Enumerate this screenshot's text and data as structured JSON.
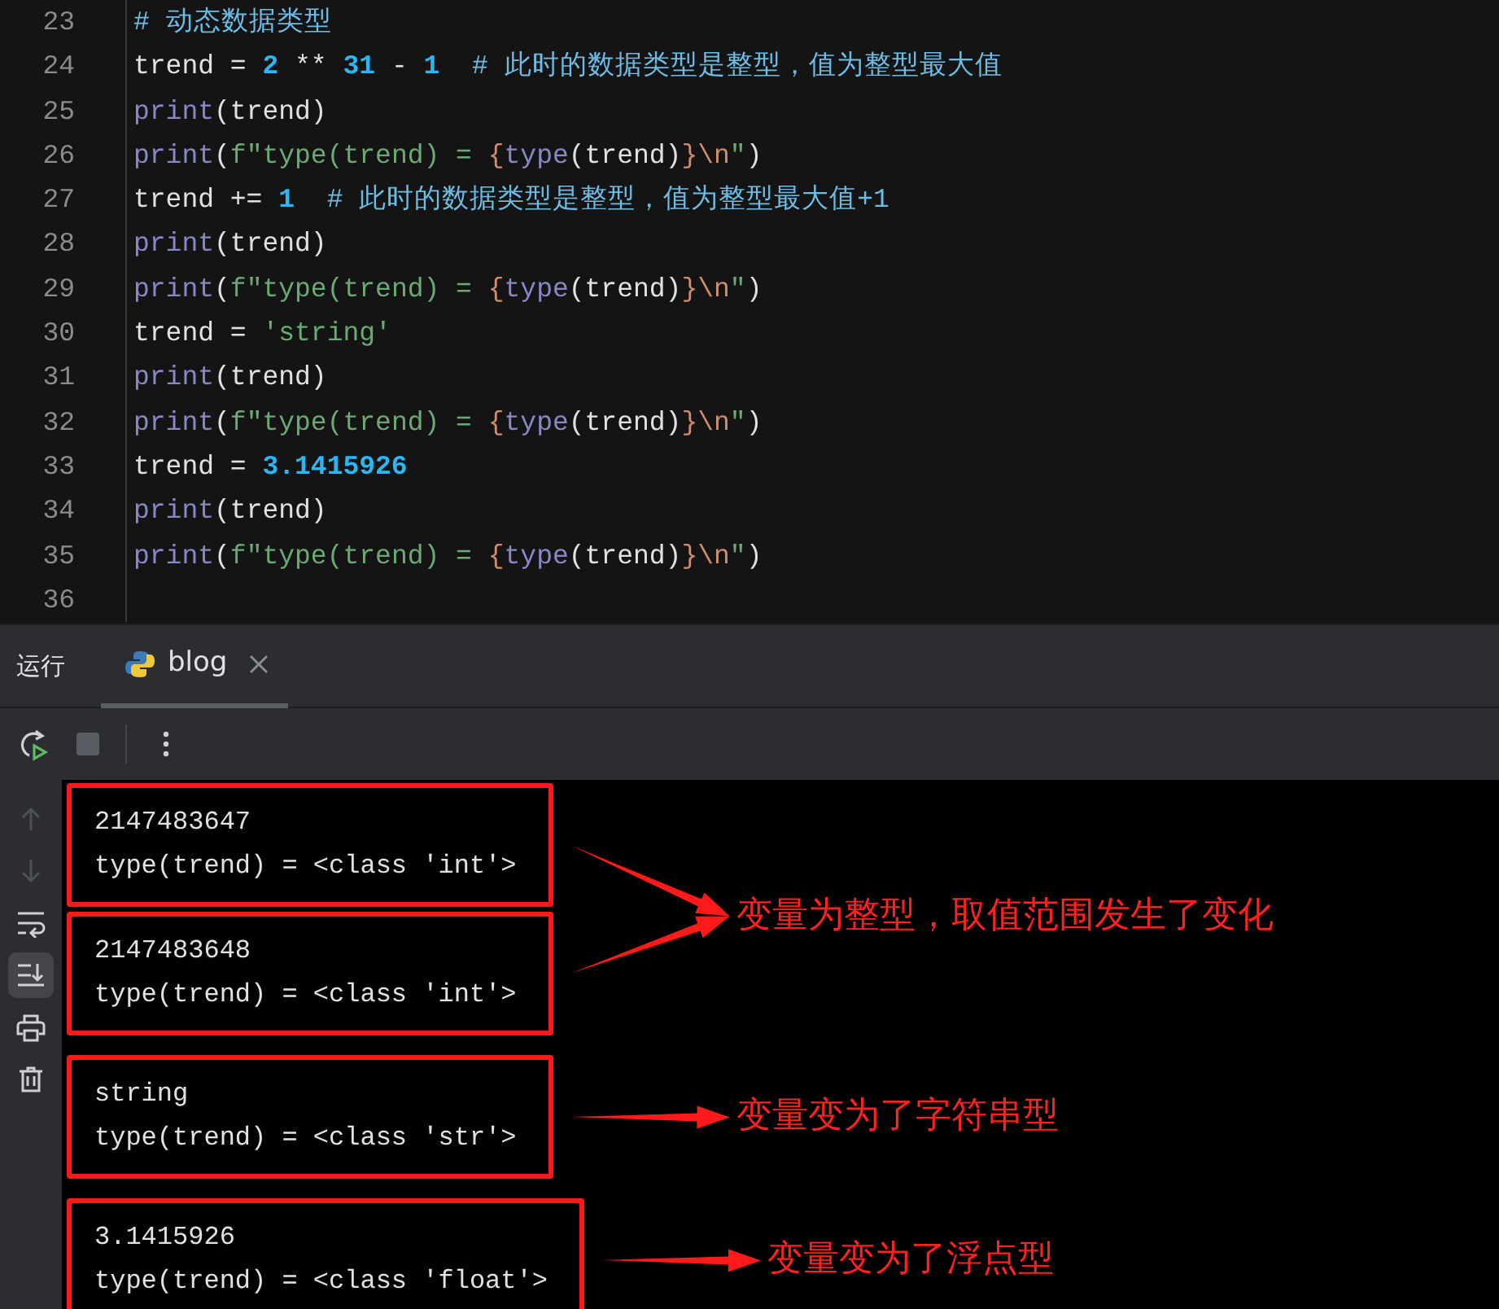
{
  "editor": {
    "lines": [
      {
        "number": "23",
        "tokens": [
          {
            "kind": "comment",
            "text": "# 动态数据类型"
          }
        ]
      },
      {
        "number": "24",
        "tokens": [
          {
            "kind": "plain",
            "text": "trend = "
          },
          {
            "kind": "number",
            "text": "2"
          },
          {
            "kind": "plain",
            "text": " ** "
          },
          {
            "kind": "number",
            "text": "31"
          },
          {
            "kind": "plain",
            "text": " - "
          },
          {
            "kind": "number",
            "text": "1"
          },
          {
            "kind": "comment",
            "text": "  # 此时的数据类型是整型，值为整型最大值"
          }
        ]
      },
      {
        "number": "25",
        "tokens": [
          {
            "kind": "builtin",
            "text": "print"
          },
          {
            "kind": "plain",
            "text": "(trend)"
          }
        ]
      },
      {
        "number": "26",
        "tokens": [
          {
            "kind": "builtin",
            "text": "print"
          },
          {
            "kind": "plain",
            "text": "("
          },
          {
            "kind": "string",
            "text": "f\"type(trend) = "
          },
          {
            "kind": "brace",
            "text": "{"
          },
          {
            "kind": "builtin",
            "text": "type"
          },
          {
            "kind": "plain",
            "text": "(trend)"
          },
          {
            "kind": "brace",
            "text": "}"
          },
          {
            "kind": "escape",
            "text": "\\n"
          },
          {
            "kind": "string",
            "text": "\""
          },
          {
            "kind": "plain",
            "text": ")"
          }
        ]
      },
      {
        "number": "27",
        "tokens": [
          {
            "kind": "plain",
            "text": "trend += "
          },
          {
            "kind": "number",
            "text": "1"
          },
          {
            "kind": "comment",
            "text": "  # 此时的数据类型是整型，值为整型最大值+1"
          }
        ]
      },
      {
        "number": "28",
        "tokens": [
          {
            "kind": "builtin",
            "text": "print"
          },
          {
            "kind": "plain",
            "text": "(trend)"
          }
        ]
      },
      {
        "number": "29",
        "tokens": [
          {
            "kind": "builtin",
            "text": "print"
          },
          {
            "kind": "plain",
            "text": "("
          },
          {
            "kind": "string",
            "text": "f\"type(trend) = "
          },
          {
            "kind": "brace",
            "text": "{"
          },
          {
            "kind": "builtin",
            "text": "type"
          },
          {
            "kind": "plain",
            "text": "(trend)"
          },
          {
            "kind": "brace",
            "text": "}"
          },
          {
            "kind": "escape",
            "text": "\\n"
          },
          {
            "kind": "string",
            "text": "\""
          },
          {
            "kind": "plain",
            "text": ")"
          }
        ]
      },
      {
        "number": "30",
        "tokens": [
          {
            "kind": "plain",
            "text": "trend = "
          },
          {
            "kind": "string",
            "text": "'string'"
          }
        ]
      },
      {
        "number": "31",
        "tokens": [
          {
            "kind": "builtin",
            "text": "print"
          },
          {
            "kind": "plain",
            "text": "(trend)"
          }
        ]
      },
      {
        "number": "32",
        "tokens": [
          {
            "kind": "builtin",
            "text": "print"
          },
          {
            "kind": "plain",
            "text": "("
          },
          {
            "kind": "string",
            "text": "f\"type(trend) = "
          },
          {
            "kind": "brace",
            "text": "{"
          },
          {
            "kind": "builtin",
            "text": "type"
          },
          {
            "kind": "plain",
            "text": "(trend)"
          },
          {
            "kind": "brace",
            "text": "}"
          },
          {
            "kind": "escape",
            "text": "\\n"
          },
          {
            "kind": "string",
            "text": "\""
          },
          {
            "kind": "plain",
            "text": ")"
          }
        ]
      },
      {
        "number": "33",
        "tokens": [
          {
            "kind": "plain",
            "text": "trend = "
          },
          {
            "kind": "number",
            "text": "3.1415926"
          }
        ]
      },
      {
        "number": "34",
        "tokens": [
          {
            "kind": "builtin",
            "text": "print"
          },
          {
            "kind": "plain",
            "text": "(trend)"
          }
        ]
      },
      {
        "number": "35",
        "tokens": [
          {
            "kind": "builtin",
            "text": "print"
          },
          {
            "kind": "plain",
            "text": "("
          },
          {
            "kind": "string",
            "text": "f\"type(trend) = "
          },
          {
            "kind": "brace",
            "text": "{"
          },
          {
            "kind": "builtin",
            "text": "type"
          },
          {
            "kind": "plain",
            "text": "(trend)"
          },
          {
            "kind": "brace",
            "text": "}"
          },
          {
            "kind": "escape",
            "text": "\\n"
          },
          {
            "kind": "string",
            "text": "\""
          },
          {
            "kind": "plain",
            "text": ")"
          }
        ]
      },
      {
        "number": "36"
      }
    ]
  },
  "run_panel": {
    "title": "运行",
    "tabs": [
      {
        "label": "blog",
        "selected": true
      }
    ],
    "side_tools": [
      {
        "kind": "up",
        "disabled": true,
        "selected": false
      },
      {
        "kind": "down",
        "disabled": true,
        "selected": false
      },
      {
        "kind": "wrap",
        "disabled": false,
        "selected": false
      },
      {
        "kind": "scroll-end",
        "disabled": false,
        "selected": true
      },
      {
        "kind": "print",
        "disabled": false,
        "selected": false
      },
      {
        "kind": "trash",
        "disabled": false,
        "selected": false
      }
    ],
    "console": {
      "groups": [
        {
          "note": "变量为整型，取值范围发生了变化",
          "blocks": [
            {
              "highlighted": true,
              "lines": [
                "2147483647",
                "type(trend) = <class 'int'>"
              ]
            },
            {
              "highlighted": true,
              "lines": [
                "2147483648",
                "type(trend) = <class 'int'>"
              ]
            }
          ]
        },
        {
          "note": "变量变为了字符串型",
          "blocks": [
            {
              "highlighted": true,
              "lines": [
                "string",
                "type(trend) = <class 'str'>"
              ]
            }
          ]
        },
        {
          "note": "变量变为了浮点型",
          "blocks": [
            {
              "highlighted": true,
              "lines": [
                "3.1415926",
                "type(trend) = <class 'float'>"
              ]
            }
          ]
        }
      ]
    }
  }
}
